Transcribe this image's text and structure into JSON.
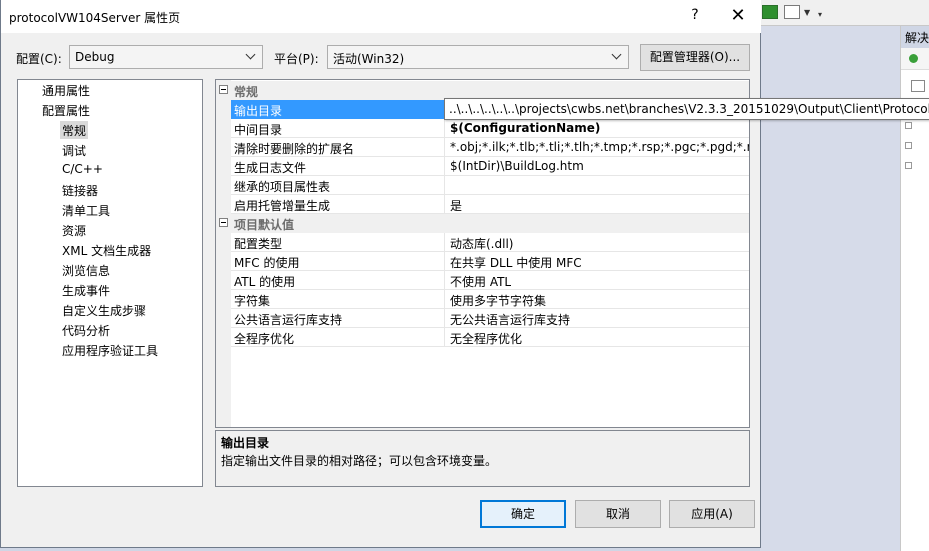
{
  "dialog": {
    "title": "protocolVW104Server 属性页",
    "help_label": "?",
    "close_label": "✕"
  },
  "config_bar": {
    "config_label": "配置(C):",
    "config_value": "Debug",
    "platform_label": "平台(P):",
    "platform_value": "活动(Win32)",
    "manager_button": "配置管理器(O)..."
  },
  "tree": {
    "items": [
      {
        "label": "通用属性",
        "level": 0
      },
      {
        "label": "配置属性",
        "level": 0
      },
      {
        "label": "常规",
        "level": 1,
        "selected": true
      },
      {
        "label": "调试",
        "level": 1
      },
      {
        "label": "C/C++",
        "level": 1
      },
      {
        "label": "链接器",
        "level": 1
      },
      {
        "label": "清单工具",
        "level": 1
      },
      {
        "label": "资源",
        "level": 1
      },
      {
        "label": "XML 文档生成器",
        "level": 1
      },
      {
        "label": "浏览信息",
        "level": 1
      },
      {
        "label": "生成事件",
        "level": 1
      },
      {
        "label": "自定义生成步骤",
        "level": 1
      },
      {
        "label": "代码分析",
        "level": 1
      },
      {
        "label": "应用程序验证工具",
        "level": 1
      }
    ]
  },
  "grid": {
    "categories": [
      {
        "name": "常规",
        "rows": [
          {
            "name": "输出目录",
            "value": "",
            "selected": true
          },
          {
            "name": "中间目录",
            "value": "$(ConfigurationName)",
            "bold": true
          },
          {
            "name": "清除时要删除的扩展名",
            "value": "*.obj;*.ilk;*.tlb;*.tli;*.tlh;*.tmp;*.rsp;*.pgc;*.pgd;*.meta;$"
          },
          {
            "name": "生成日志文件",
            "value": "$(IntDir)\\BuildLog.htm"
          },
          {
            "name": "继承的项目属性表",
            "value": ""
          },
          {
            "name": "启用托管增量生成",
            "value": "是"
          }
        ]
      },
      {
        "name": "项目默认值",
        "rows": [
          {
            "name": "配置类型",
            "value": "动态库(.dll)"
          },
          {
            "name": "MFC 的使用",
            "value": "在共享 DLL 中使用 MFC"
          },
          {
            "name": "ATL 的使用",
            "value": "不使用 ATL"
          },
          {
            "name": "字符集",
            "value": "使用多字节字符集"
          },
          {
            "name": "公共语言运行库支持",
            "value": "无公共语言运行库支持"
          },
          {
            "name": "全程序优化",
            "value": "无全程序优化"
          }
        ]
      }
    ],
    "tooltip": "..\\..\\..\\..\\..\\..\\projects\\cwbs.net\\branches\\V2.3.3_20151029\\Output\\Client\\Protocols"
  },
  "description": {
    "title": "输出目录",
    "text": "指定输出文件目录的相对路径；可以包含环境变量。"
  },
  "buttons": {
    "ok": "确定",
    "cancel": "取消",
    "apply": "应用(A)"
  },
  "background": {
    "panel_title": "解决"
  }
}
